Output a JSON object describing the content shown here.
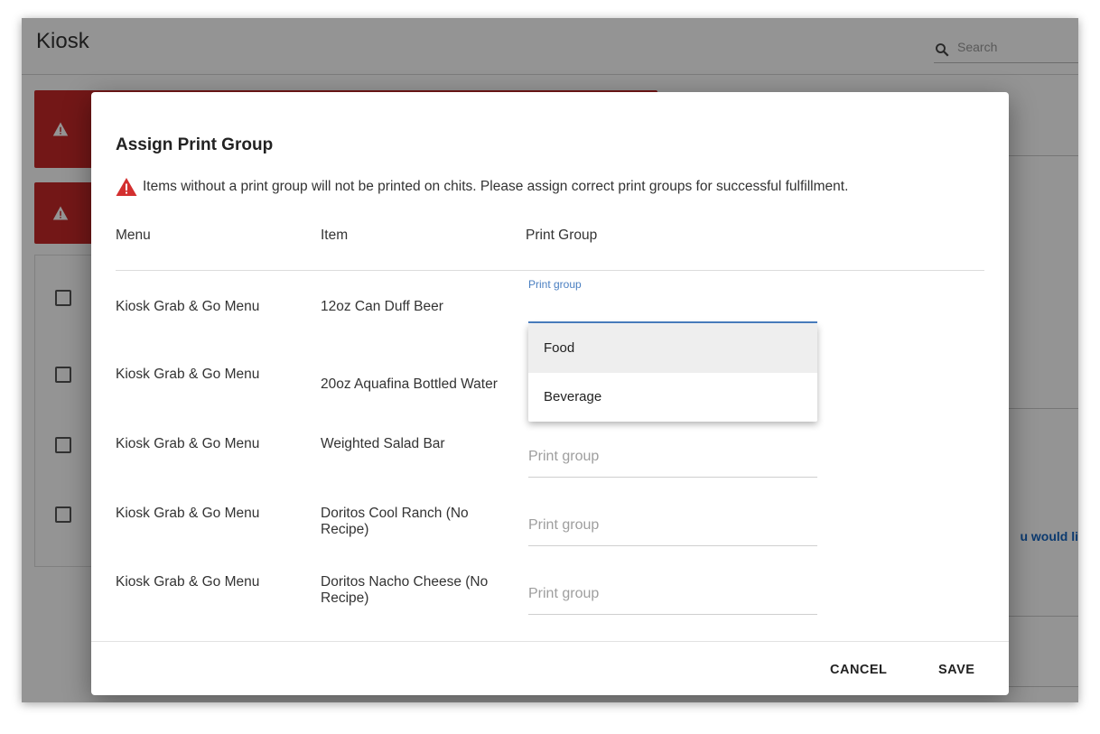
{
  "app": {
    "title": "Kiosk",
    "search_placeholder": "Search"
  },
  "background": {
    "right_snippet": "u would li"
  },
  "dialog": {
    "title": "Assign Print Group",
    "warning": "Items without a print group will not be printed on chits. Please assign correct print groups for successful fulfillment.",
    "columns": {
      "menu": "Menu",
      "item": "Item",
      "print_group": "Print Group"
    },
    "active_field_label": "Print group",
    "field_placeholder": "Print group",
    "rows": [
      {
        "menu": "Kiosk Grab & Go Menu",
        "item": "12oz Can Duff Beer"
      },
      {
        "menu": "Kiosk Grab & Go Menu",
        "item": "20oz Aquafina Bottled Water"
      },
      {
        "menu": "Kiosk Grab & Go Menu",
        "item": "Weighted Salad Bar"
      },
      {
        "menu": "Kiosk Grab & Go Menu",
        "item": "Doritos Cool Ranch (No Recipe)"
      },
      {
        "menu": "Kiosk Grab & Go Menu",
        "item": "Doritos Nacho Cheese (No Recipe)"
      }
    ],
    "dropdown_options": [
      "Food",
      "Beverage"
    ],
    "buttons": {
      "cancel": "CANCEL",
      "save": "SAVE"
    }
  },
  "colors": {
    "alert_red": "#c62828",
    "accent_blue": "#4a7fc1",
    "link_blue": "#1565c0"
  }
}
